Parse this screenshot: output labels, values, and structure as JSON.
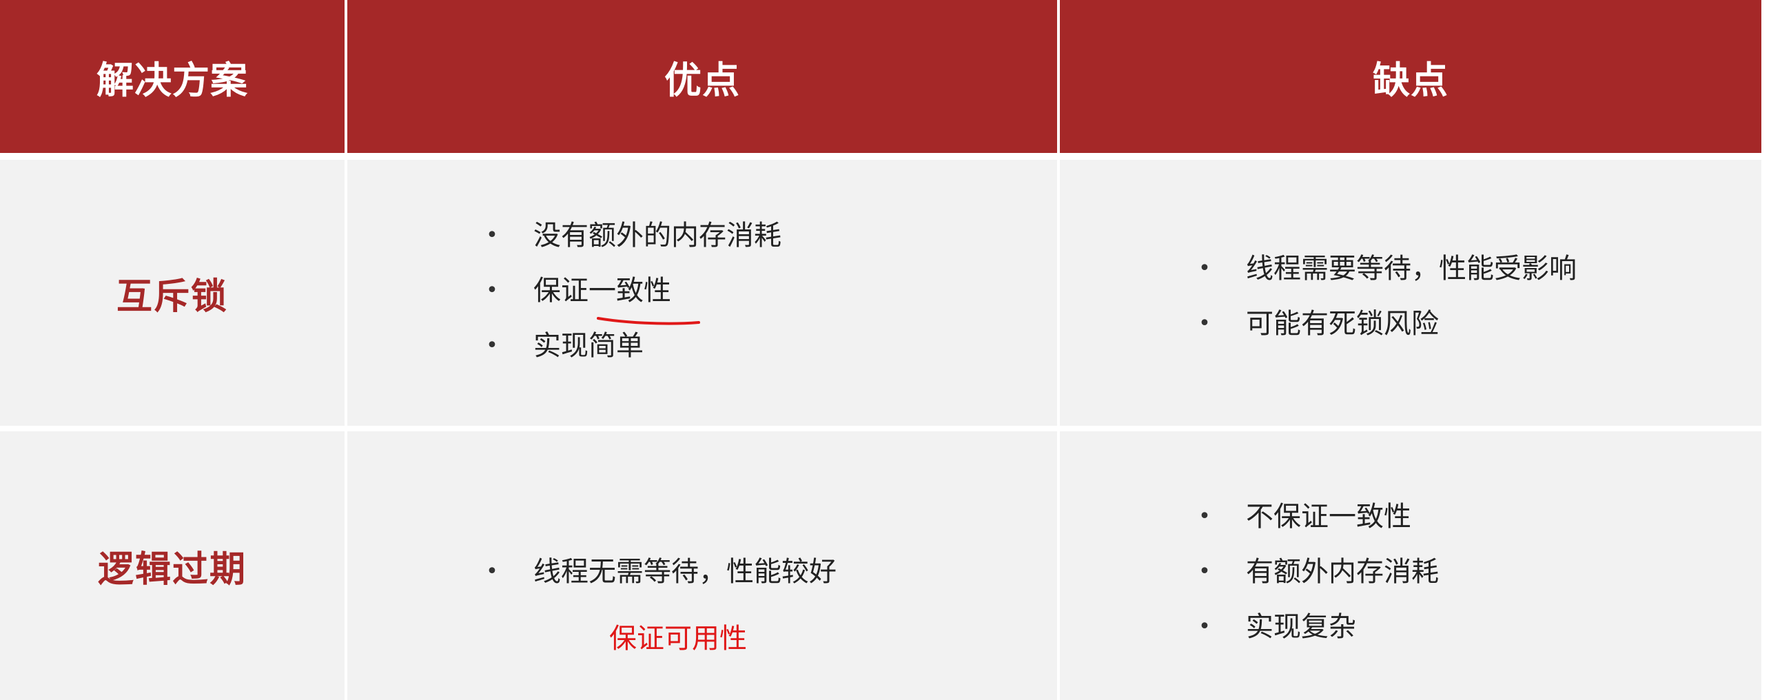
{
  "table": {
    "headers": [
      "解决方案",
      "优点",
      "缺点"
    ],
    "rows": [
      {
        "solution": "互斥锁",
        "pros": [
          "没有额外的内存消耗",
          "保证一致性",
          "实现简单"
        ],
        "cons": [
          "线程需要等待，性能受影响",
          "可能有死锁风险"
        ]
      },
      {
        "solution": "逻辑过期",
        "pros": [
          "线程无需等待，性能较好"
        ],
        "cons": [
          "不保证一致性",
          "有额外内存消耗",
          "实现复杂"
        ]
      }
    ]
  },
  "annotations": {
    "handwritten_note": "保证可用性"
  },
  "colors": {
    "header_bg": "#a52828",
    "label_text": "#a52828",
    "body_bg": "#f2f2f2",
    "annotation": "#e01818"
  }
}
